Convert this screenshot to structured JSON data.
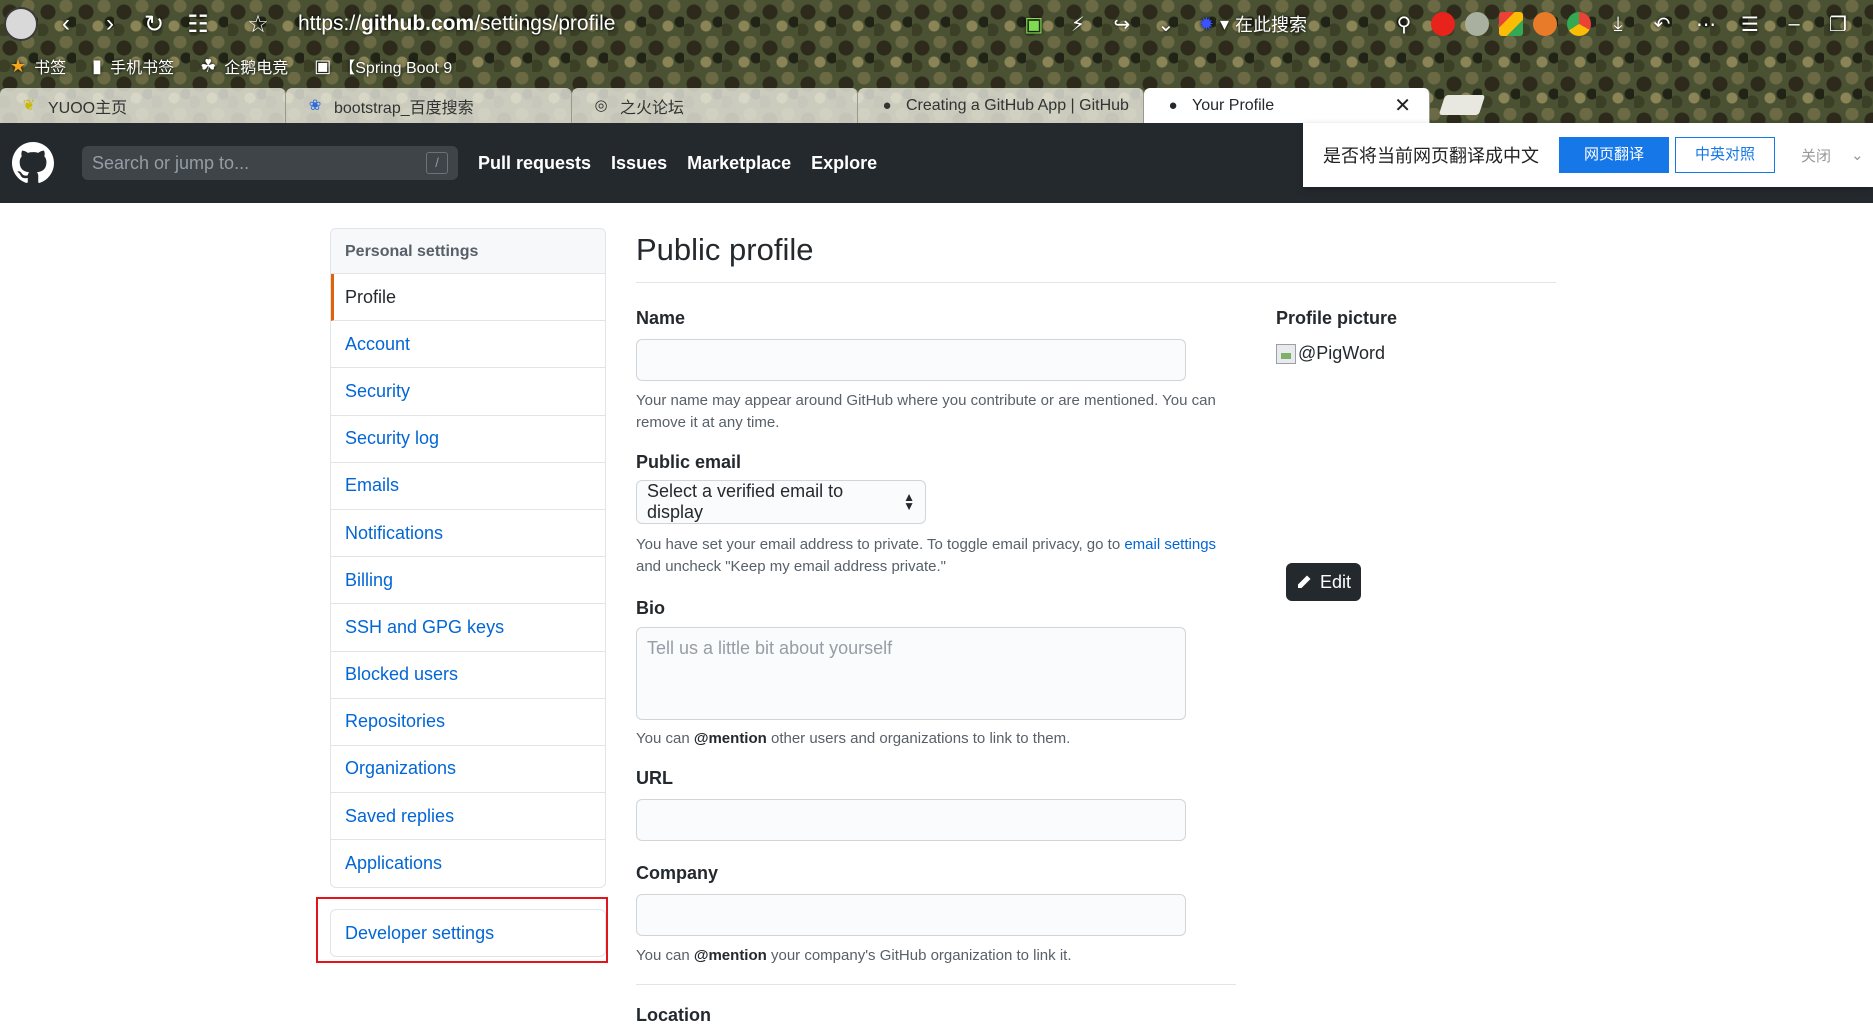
{
  "browser": {
    "url_prefix": "https://",
    "url_domain": "github.com",
    "url_path": "/settings/profile",
    "search_engine_label": "在此搜索",
    "bookmarks": [
      {
        "label": "书签",
        "icon": "star-icon"
      },
      {
        "label": "手机书签",
        "icon": "phone-icon"
      },
      {
        "label": "企鹅电竞",
        "icon": "gamepad-icon"
      },
      {
        "label": "【Spring Boot 9",
        "icon": "folder-icon"
      }
    ],
    "tabs": [
      {
        "label": "YUOO主页",
        "icon": "leaf-icon"
      },
      {
        "label": "bootstrap_百度搜索",
        "icon": "baidu-icon"
      },
      {
        "label": "之火论坛",
        "icon": "globe-icon"
      },
      {
        "label": "Creating a GitHub App | GitHub",
        "icon": "github-icon"
      },
      {
        "label": "Your Profile",
        "icon": "github-icon"
      }
    ]
  },
  "github_header": {
    "search_placeholder": "Search or jump to...",
    "search_shortcut": "/",
    "nav": [
      "Pull requests",
      "Issues",
      "Marketplace",
      "Explore"
    ]
  },
  "translate_bar": {
    "prompt": "是否将当前网页翻译成中文",
    "translate_label": "网页翻译",
    "compare_label": "中英对照",
    "close_label": "关闭"
  },
  "sidebar": {
    "heading": "Personal settings",
    "items": [
      {
        "label": "Profile",
        "selected": true
      },
      {
        "label": "Account"
      },
      {
        "label": "Security"
      },
      {
        "label": "Security log"
      },
      {
        "label": "Emails"
      },
      {
        "label": "Notifications"
      },
      {
        "label": "Billing"
      },
      {
        "label": "SSH and GPG keys"
      },
      {
        "label": "Blocked users"
      },
      {
        "label": "Repositories"
      },
      {
        "label": "Organizations"
      },
      {
        "label": "Saved replies"
      },
      {
        "label": "Applications"
      }
    ],
    "developer_settings": "Developer settings"
  },
  "main": {
    "title": "Public profile",
    "name_label": "Name",
    "name_value": "",
    "name_note": "Your name may appear around GitHub where you contribute or are mentioned. You can remove it at any time.",
    "email_label": "Public email",
    "email_select": "Select a verified email to display",
    "email_note_pre": "You have set your email address to private. To toggle email privacy, go to ",
    "email_note_link": "email settings",
    "email_note_post": " and uncheck \"Keep my email address private.\"",
    "bio_label": "Bio",
    "bio_placeholder": "Tell us a little bit about yourself",
    "bio_note_pre": "You can ",
    "bio_note_bold": "@mention",
    "bio_note_post": " other users and organizations to link to them.",
    "url_label": "URL",
    "company_label": "Company",
    "company_note_pre": "You can ",
    "company_note_bold": "@mention",
    "company_note_post": " your company's GitHub organization to link it.",
    "location_label": "Location",
    "picture_label": "Profile picture",
    "picture_alt": "@PigWord",
    "edit_label": "Edit"
  },
  "colors": {
    "link": "#0366d6",
    "header_bg": "#24292e",
    "selected_accent": "#e36209",
    "highlight_box": "#e0161a",
    "translate_blue": "#1677e8"
  }
}
